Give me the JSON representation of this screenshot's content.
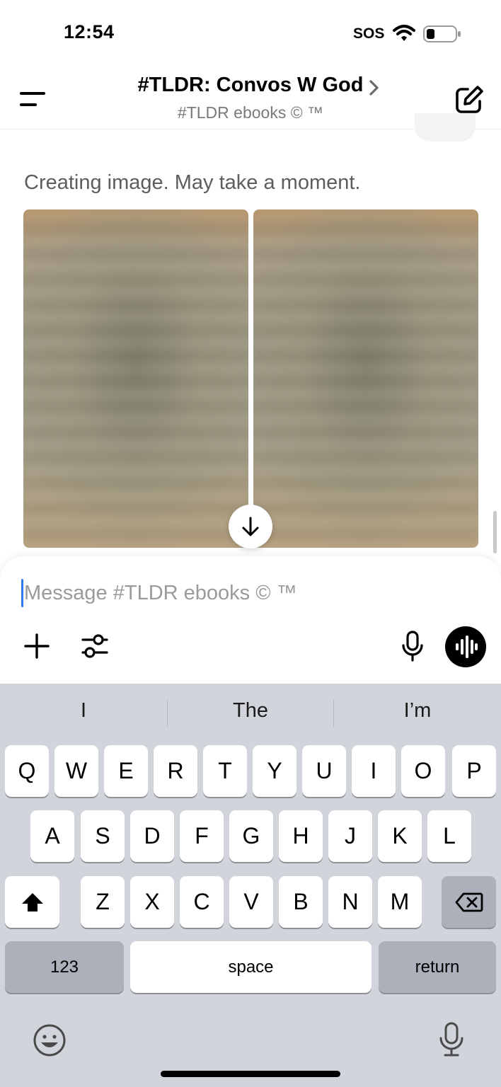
{
  "status_bar": {
    "time": "12:54",
    "carrier": "SOS",
    "wifi_icon": "wifi-icon",
    "battery_icon": "battery-low-icon"
  },
  "header": {
    "title": "#TLDR: Convos W God",
    "subtitle": "#TLDR ebooks © ™",
    "menu_icon": "menu-icon",
    "chevron_icon": "chevron-right-icon",
    "compose_icon": "new-chat-icon"
  },
  "chat": {
    "status_message": "Creating image. May take a moment.",
    "images": [
      "blurred-image-preview-1",
      "blurred-image-preview-2"
    ],
    "scroll_down_icon": "arrow-down-icon"
  },
  "composer": {
    "placeholder": "Message #TLDR ebooks © ™",
    "value": "",
    "add_icon": "plus-icon",
    "options_icon": "sliders-icon",
    "mic_icon": "microphone-icon",
    "voice_icon": "voice-wave-icon"
  },
  "keyboard": {
    "suggestions": [
      "I",
      "The",
      "I’m"
    ],
    "row1": [
      "Q",
      "W",
      "E",
      "R",
      "T",
      "Y",
      "U",
      "I",
      "O",
      "P"
    ],
    "row2": [
      "A",
      "S",
      "D",
      "F",
      "G",
      "H",
      "J",
      "K",
      "L"
    ],
    "row3": [
      "Z",
      "X",
      "C",
      "V",
      "B",
      "N",
      "M"
    ],
    "numbers_label": "123",
    "space_label": "space",
    "return_label": "return",
    "shift_icon": "shift-icon",
    "delete_icon": "backspace-icon",
    "emoji_icon": "emoji-icon",
    "dictation_icon": "microphone-icon"
  },
  "colors": {
    "accent_caret": "#2f7cf6",
    "keyboard_bg": "#d1d4da",
    "dark_key": "#abb0ba"
  }
}
